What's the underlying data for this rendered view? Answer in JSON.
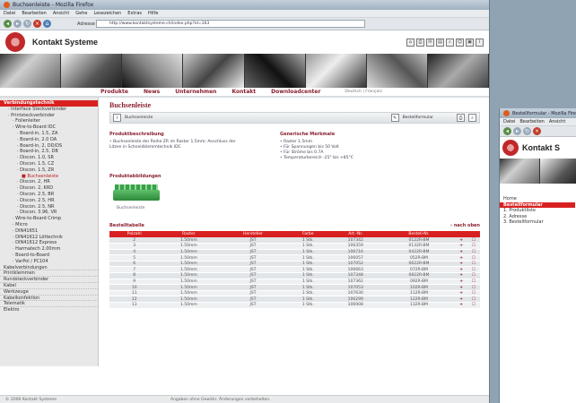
{
  "window": {
    "title": "Buchsenleiste - Mozilla Firefox",
    "menu": [
      "Datei",
      "Bearbeiten",
      "Ansicht",
      "Gehe",
      "Lesezeichen",
      "Extras",
      "Hilfe"
    ],
    "url_label": "Adresse",
    "url": "http://www.kontaktsysteme.ch/index.php?id=163"
  },
  "site": {
    "name": "Kontakt Systeme",
    "nav": [
      "Produkte",
      "News",
      "Unternehmen",
      "Kontakt",
      "Downloadcenter"
    ],
    "lang": "Deutsch | Français",
    "header_icons": [
      "home-icon",
      "print-icon",
      "mail-icon",
      "cart-icon",
      "search-icon",
      "user-icon",
      "lock-icon",
      "info-icon"
    ]
  },
  "sidebar": {
    "items": [
      {
        "label": "Verbindungstechnik",
        "indent": 0,
        "highlight": true
      },
      {
        "label": "Interface Steckverbinder",
        "indent": 1
      },
      {
        "label": "Printsteckverbinder",
        "indent": 1
      },
      {
        "label": "Folienleiter",
        "indent": 2
      },
      {
        "label": "Wire-to-Board IDC",
        "indent": 2
      },
      {
        "label": "Board-in, 1.5, ZA",
        "indent": 3
      },
      {
        "label": "Board-in, 2.0 DA",
        "indent": 3
      },
      {
        "label": "Board-in, 2, DD/DS",
        "indent": 3
      },
      {
        "label": "Board-in, 2.5, DB",
        "indent": 3
      },
      {
        "label": "Discon. 1.0, SR",
        "indent": 3
      },
      {
        "label": "Discon. 1.5, CZ",
        "indent": 3
      },
      {
        "label": "Discon. 1.5, ZR",
        "indent": 3
      },
      {
        "label": "Buchsenleiste",
        "indent": 4,
        "red": true
      },
      {
        "label": "Discon. 2, HR",
        "indent": 3
      },
      {
        "label": "Discon. 2, KRD",
        "indent": 3
      },
      {
        "label": "Discon. 2.5, BR",
        "indent": 3
      },
      {
        "label": "Discon. 2.5, HR",
        "indent": 3
      },
      {
        "label": "Discon. 2.5, NR",
        "indent": 3
      },
      {
        "label": "Discon. 3.96, VR",
        "indent": 3
      },
      {
        "label": "Wire-to-Board Crimp",
        "indent": 2
      },
      {
        "label": "Micro",
        "indent": 2
      },
      {
        "label": "DIN41651",
        "indent": 2
      },
      {
        "label": "DIN41612 Löttechnik",
        "indent": 2
      },
      {
        "label": "DIN41612 Express",
        "indent": 2
      },
      {
        "label": "Harmatech 2.00mm",
        "indent": 2
      },
      {
        "label": "Board-to-Board",
        "indent": 2
      },
      {
        "label": "VarPol / PC104",
        "indent": 2
      },
      {
        "label": "Kabelverbindungen",
        "indent": 0,
        "sep": true
      },
      {
        "label": "Printklemmen",
        "indent": 0,
        "sep": true
      },
      {
        "label": "Rundsteckverbinder",
        "indent": 0,
        "sep": true
      },
      {
        "label": "Kabel",
        "indent": 0,
        "sep": true
      },
      {
        "label": "Werkzeuge",
        "indent": 0,
        "sep": true
      },
      {
        "label": "Kabelkonfektion",
        "indent": 0,
        "sep": true
      },
      {
        "label": "Telematik",
        "indent": 0,
        "sep": true
      },
      {
        "label": "Elektro",
        "indent": 0
      }
    ]
  },
  "main": {
    "title": "Buchsenleiste",
    "toolbar_left": "Buchsenleiste",
    "toolbar_right": "Bestellformular",
    "desc_title": "Produktbeschreibung",
    "desc_items": [
      "Buchsenleiste der Reihe ZR im Raster 1.5mm; Anschluss der Litzen in Schneidklemmtechnik IDC"
    ],
    "tech_title": "Generische Merkmale",
    "tech_items": [
      "Raster 1.5mm",
      "Für Spannungen bis 50 Volt",
      "Für Ströme bis 0.7A",
      "Temperaturbereich -25° bis +85°C"
    ],
    "images_title": "Produktabbildungen",
    "image_caption": "Buchsenleiste",
    "table_title": "Bestelltabelle",
    "back_link": "nach oben",
    "columns": [
      "Polzahl",
      "Raster",
      "Hersteller",
      "Farbe",
      "Art.-Nr.",
      "Bestell-Nr.",
      "",
      ""
    ],
    "rows": [
      [
        "2",
        "1.50mm",
        "JST",
        "1 Stk.",
        "107342",
        "0122R-BM",
        "+",
        "☐"
      ],
      [
        "3",
        "1.50mm",
        "JST",
        "1 Stk.",
        "106359",
        "0132R-BM",
        "+",
        "☐"
      ],
      [
        "4",
        "1.50mm",
        "JST",
        "1 Stk.",
        "106716",
        "0422R-BM",
        "+",
        "☐"
      ],
      [
        "5",
        "1.50mm",
        "JST",
        "1 Stk.",
        "106057",
        "052R-BM",
        "+",
        "☐"
      ],
      [
        "6",
        "1.50mm",
        "JST",
        "1 Stk.",
        "107052",
        "0622R-BM",
        "+",
        "☐"
      ],
      [
        "7",
        "1.50mm",
        "JST",
        "1 Stk.",
        "106663",
        "072R-BM",
        "+",
        "☐"
      ],
      [
        "8",
        "1.50mm",
        "JST",
        "1 Stk.",
        "107348",
        "0822R-BM",
        "+",
        "☐"
      ],
      [
        "9",
        "1.50mm",
        "JST",
        "1 Stk.",
        "107362",
        "092R-BM",
        "+",
        "☐"
      ],
      [
        "10",
        "1.50mm",
        "JST",
        "1 Stk.",
        "107053",
        "102R-BM",
        "+",
        "☐"
      ],
      [
        "11",
        "1.50mm",
        "JST",
        "1 Stk.",
        "107630",
        "112R-BM",
        "+",
        "☐"
      ],
      [
        "12",
        "1.50mm",
        "JST",
        "1 Stk.",
        "106299",
        "122R-BM",
        "+",
        "☐"
      ],
      [
        "13",
        "1.50mm",
        "JST",
        "1 Stk.",
        "106908",
        "132R-BM",
        "+",
        "☐"
      ]
    ]
  },
  "footer": {
    "copyright": "© 2006 Kontakt Systeme",
    "note": "Angaben ohne Gewähr. Änderungen vorbehalten."
  },
  "window2": {
    "title": "Bestellformular - Mozilla Fire",
    "menu": [
      "Datei",
      "Bearbeiten",
      "Ansicht"
    ],
    "site_name": "Kontakt S",
    "items": [
      {
        "label": "Home",
        "highlight": false
      },
      {
        "label": "Bestellformular",
        "highlight": true
      },
      {
        "label": "1. Produktliste",
        "highlight": false
      },
      {
        "label": "2. Adresse",
        "highlight": false
      },
      {
        "label": "3. Bestellformular",
        "highlight": false
      }
    ]
  },
  "colors": {
    "accent_red": "#d92020",
    "title_red": "#8a2030"
  }
}
